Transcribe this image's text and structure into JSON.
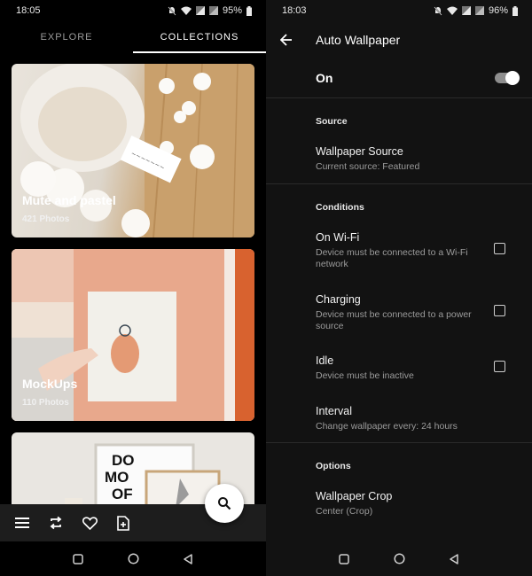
{
  "left": {
    "status": {
      "time": "18:05",
      "battery": "95%"
    },
    "tabs": [
      {
        "label": "EXPLORE",
        "active": false
      },
      {
        "label": "COLLECTIONS",
        "active": true
      }
    ],
    "collections": [
      {
        "title": "Mute and pastel",
        "count": "421 Photos"
      },
      {
        "title": "MockUps",
        "count": "110 Photos"
      },
      {
        "title": "",
        "count": ""
      }
    ],
    "appbar": {
      "icons": [
        "menu-icon",
        "repeat-icon",
        "heart-icon",
        "add-file-icon"
      ],
      "fab_icon": "search-icon"
    }
  },
  "right": {
    "status": {
      "time": "18:03",
      "battery": "96%"
    },
    "title": "Auto Wallpaper",
    "master_toggle": {
      "label": "On",
      "checked": true
    },
    "sections": {
      "source": "Source",
      "conditions": "Conditions",
      "options": "Options"
    },
    "wallpaper_source": {
      "title": "Wallpaper Source",
      "summary": "Current source: Featured"
    },
    "on_wifi": {
      "title": "On Wi-Fi",
      "summary": "Device must be connected to a Wi-Fi network",
      "checked": false
    },
    "charging": {
      "title": "Charging",
      "summary": "Device must be connected to a power source",
      "checked": false
    },
    "idle": {
      "title": "Idle",
      "summary": "Device must be inactive",
      "checked": false
    },
    "interval": {
      "title": "Interval",
      "summary": "Change wallpaper every: 24 hours"
    },
    "wallpaper_crop": {
      "title": "Wallpaper Crop",
      "summary": "Center (Crop)"
    }
  },
  "colors": {
    "background_right": "#121212",
    "background_left": "#000000",
    "accent": "#ffffff"
  }
}
